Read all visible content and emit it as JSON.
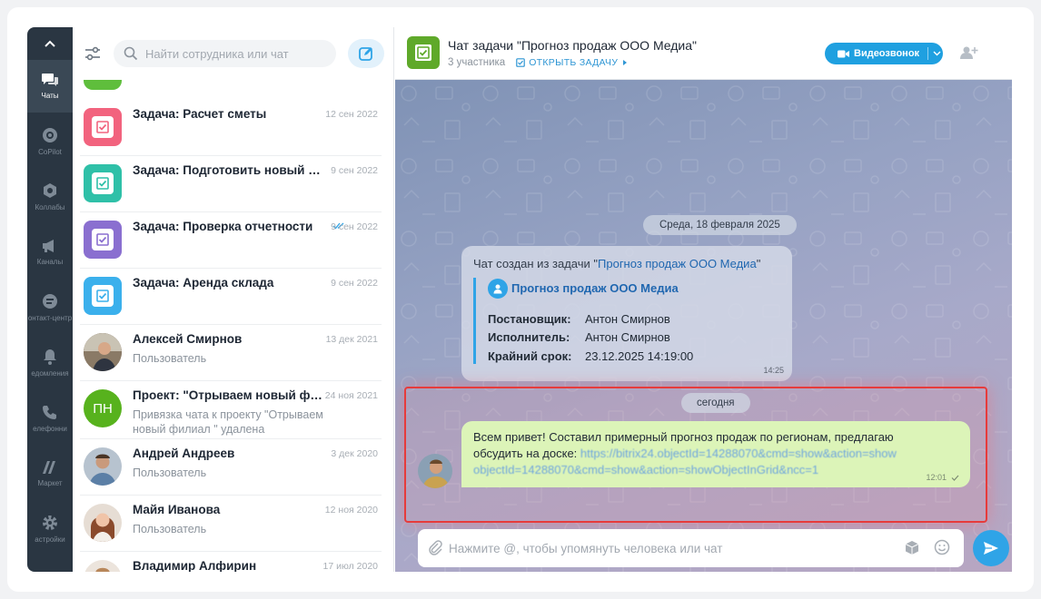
{
  "nav": {
    "items": [
      {
        "label": "Чаты",
        "icon": "chats-icon"
      },
      {
        "label": "CoPilot",
        "icon": "copilot-icon"
      },
      {
        "label": "Коллабы",
        "icon": "collabs-icon"
      },
      {
        "label": "Каналы",
        "icon": "channels-icon"
      },
      {
        "label": "онтакт-центр",
        "icon": "contact-center-icon"
      },
      {
        "label": "едомления",
        "icon": "bell-icon"
      },
      {
        "label": "елефонни",
        "icon": "phone-icon"
      },
      {
        "label": "Маркет",
        "icon": "market-icon"
      },
      {
        "label": "астройки",
        "icon": "gear-icon"
      }
    ]
  },
  "search": {
    "placeholder": "Найти сотрудника или чат"
  },
  "chats": [
    {
      "title": "Задача: Расчет сметы",
      "date": "12 сен 2022",
      "subtitle": "",
      "avatar_color": "#f2637e",
      "kind": "task"
    },
    {
      "title": "Задача: Подготовить новый дог...",
      "date": "9 сен 2022",
      "subtitle": "",
      "avatar_color": "#2fc0a8",
      "kind": "task"
    },
    {
      "title": "Задача: Проверка отчетности",
      "date": "9 сен 2022",
      "subtitle": "",
      "avatar_color": "#8a6fd0",
      "kind": "task",
      "read": true
    },
    {
      "title": "Задача: Аренда склада",
      "date": "9 сен 2022",
      "subtitle": "",
      "avatar_color": "#3bb0ec",
      "kind": "task"
    },
    {
      "title": "Алексей Смирнов",
      "date": "13 дек 2021",
      "subtitle": "Пользователь",
      "kind": "user"
    },
    {
      "title": "Проект: \"Отрываем новый фи...",
      "date": "24 ноя 2021",
      "subtitle": "Привязка чата к проекту \"Отрываем новый филиал \" удалена",
      "avatar_color": "#57b21d",
      "initials": "ПН",
      "kind": "project"
    },
    {
      "title": "Андрей Андреев",
      "date": "3 дек 2020",
      "subtitle": "Пользователь",
      "kind": "user"
    },
    {
      "title": "Майя Иванова",
      "date": "12 ноя 2020",
      "subtitle": "Пользователь",
      "kind": "user"
    },
    {
      "title": "Владимир Алфирин",
      "date": "17 июл 2020",
      "subtitle": "",
      "kind": "user"
    }
  ],
  "chat": {
    "title": "Чат задачи \"Прогноз продаж ООО Медиа\"",
    "participants": "3 участника",
    "open_task": "ОТКРЫТЬ ЗАДАЧУ",
    "video_call": "Видеозвонок",
    "date_pill": "Среда, 18 февраля 2025",
    "today_pill": "сегодня",
    "system_message": {
      "prefix": "Чат создан из задачи \"",
      "link": "Прогноз продаж ООО Медиа",
      "suffix": "\"",
      "task_name": "Прогноз продаж ООО Медиа",
      "fields": [
        {
          "key": "Постановщик:",
          "value": "Антон Смирнов"
        },
        {
          "key": "Исполнитель:",
          "value": "Антон Смирнов"
        },
        {
          "key": "Крайний срок:",
          "value": "23.12.2025 14:19:00"
        }
      ],
      "time": "14:25"
    },
    "message": {
      "text": "Всем привет! Составил примерный прогноз продаж по регионам, предлагаю обсудить на доске: ",
      "url": "https://bitrix24.objectId=14288070&cmd=show&action=show objectId=14288070&cmd=show&action=showObjectInGrid&ncc=1",
      "time": "12:01"
    },
    "composer_placeholder": "Нажмите @, чтобы упомянуть человека или чат"
  }
}
